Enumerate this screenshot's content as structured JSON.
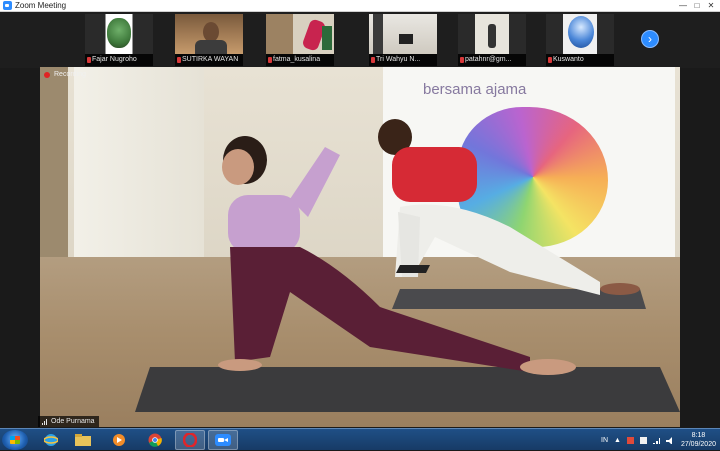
{
  "window": {
    "title": "Zoom Meeting",
    "controls": [
      "—",
      "□",
      "✕"
    ]
  },
  "gallery": {
    "participants": [
      {
        "name": "Fajar Nugroho"
      },
      {
        "name": "SUTIRKA WAYAN"
      },
      {
        "name": "fatma_kusalina"
      },
      {
        "name": "Tri Wahyu N..."
      },
      {
        "name": "patahnr@gm..."
      },
      {
        "name": "Kuswanto"
      }
    ],
    "next_glyph": "›"
  },
  "main_video": {
    "recording_label": "Recording",
    "speaker_name": "Ode Purnama",
    "banner_text": "bersama  ajama"
  },
  "taskbar": {
    "language": "IN",
    "time": "8:18",
    "date": "27/09/2020",
    "apps": [
      "windows-explorer-icon",
      "ie-icon",
      "file-explorer-icon",
      "media-player-icon",
      "chrome-icon",
      "opera-icon",
      "zoom-icon"
    ]
  },
  "colors": {
    "zoom_blue": "#2d8cff",
    "record_red": "#e02424",
    "taskbar": "#1f4f86"
  }
}
